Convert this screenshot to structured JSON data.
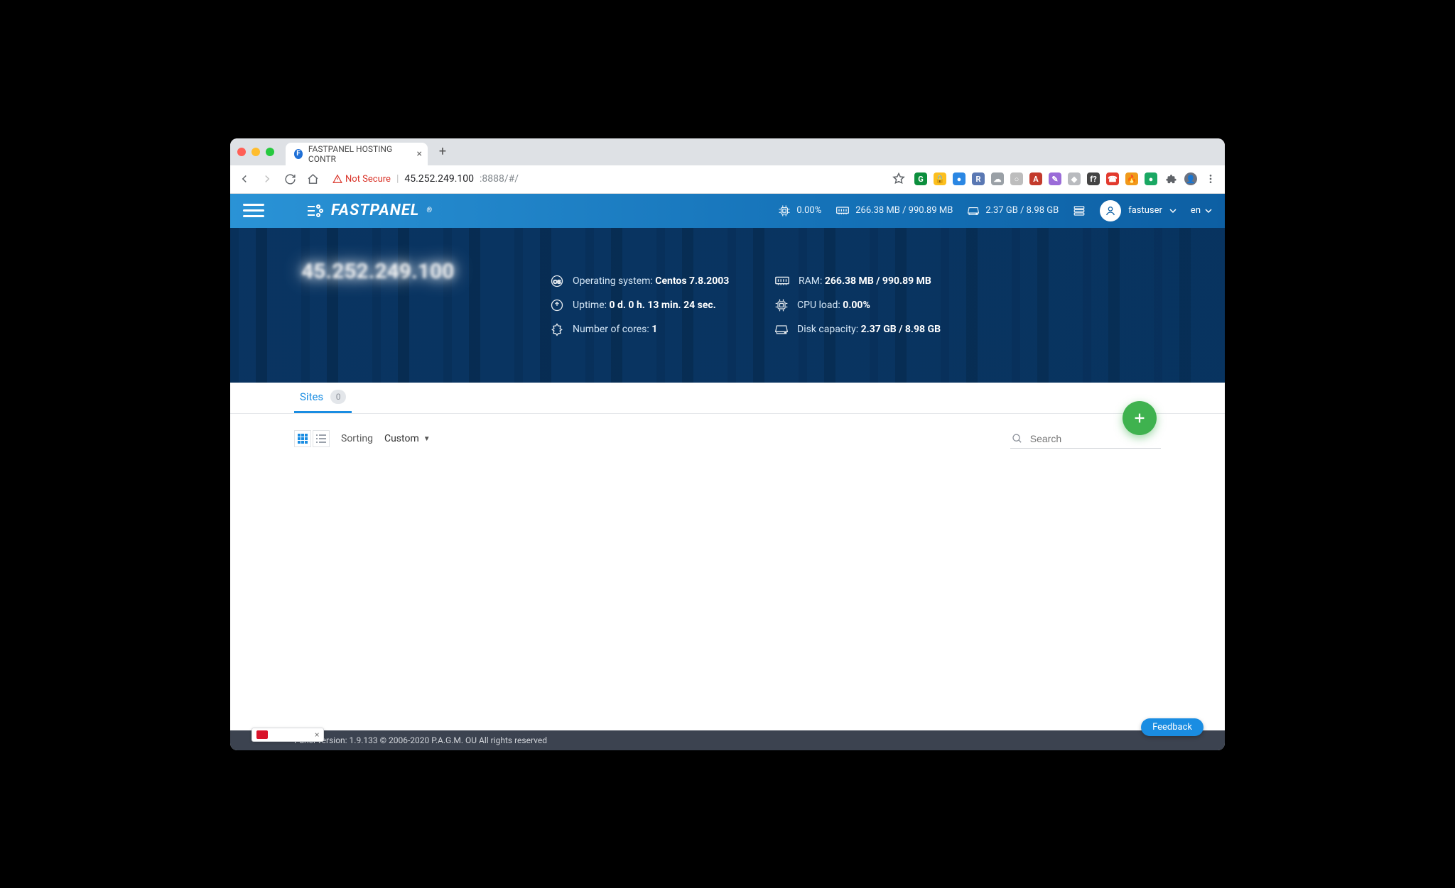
{
  "browser": {
    "tab_title": "FASTPANEL HOSTING CONTR",
    "not_secure_label": "Not Secure",
    "url_host": "45.252.249.100",
    "url_port": ":8888/#/",
    "star_tooltip": "star"
  },
  "topbar": {
    "cpu_pct": "0.00%",
    "ram_stat": "266.38 MB / 990.89 MB",
    "disk_stat": "2.37 GB / 8.98 GB",
    "username": "fastuser",
    "lang": "en"
  },
  "hero": {
    "ip_display": "45.252.249.100",
    "os_label": "Operating system:",
    "os_value": "Centos 7.8.2003",
    "uptime_label": "Uptime:",
    "uptime_value": "0 d. 0 h. 13 min. 24 sec.",
    "cores_label": "Number of cores:",
    "cores_value": "1",
    "ram_label": "RAM:",
    "ram_value": "266.38 MB / 990.89 MB",
    "cpu_label": "CPU load:",
    "cpu_value": "0.00%",
    "disk_label": "Disk capacity:",
    "disk_value": "2.37 GB / 8.98 GB"
  },
  "sites": {
    "tab_label": "Sites",
    "count": "0",
    "sorting_label": "Sorting",
    "sorting_value": "Custom",
    "search_placeholder": "Search"
  },
  "footer": {
    "text": "Panel version: 1.9.133 © 2006-2020 P.A.G.M. OU All rights reserved"
  },
  "feedback": {
    "label": "Feedback"
  }
}
